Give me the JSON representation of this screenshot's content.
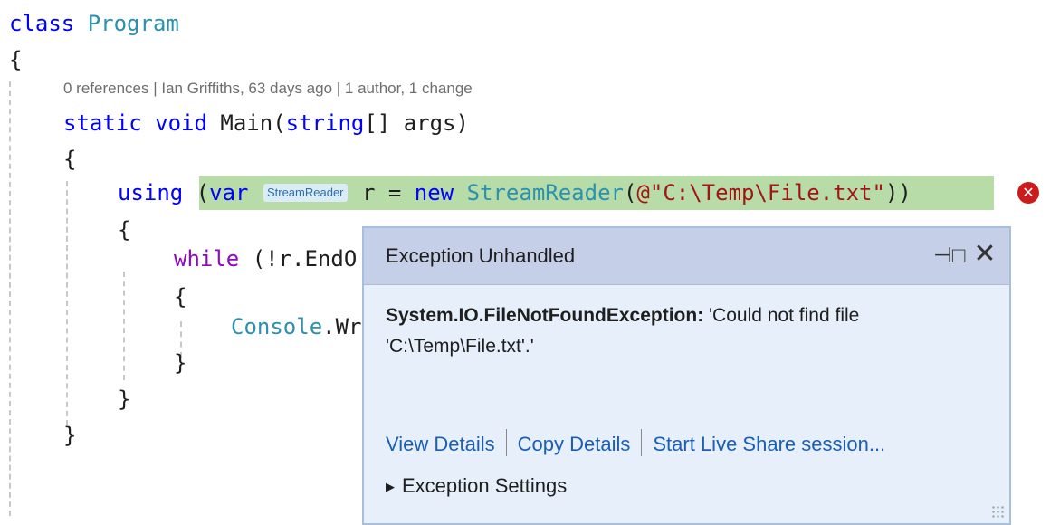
{
  "code": {
    "class_kw": "class",
    "class_name": "Program",
    "brace_open": "{",
    "brace_close": "}",
    "codelens": "0 references | Ian Griffiths, 63 days ago | 1 author, 1 change",
    "main_static": "static",
    "main_void": "void",
    "main_name": "Main(",
    "main_string": "string",
    "main_args": "[] args)",
    "using_kw": "using",
    "using_open": "(",
    "using_var": "var",
    "type_hint": "StreamReader",
    "using_mid": "r = ",
    "using_new": "new",
    "using_type": "StreamReader",
    "using_paren": "(",
    "using_str": "@\"C:\\Temp\\File.txt\"",
    "using_close": "))",
    "while_kw": "while",
    "while_rest": "(!r.EndO",
    "console_type": "Console",
    "console_rest": ".Wr"
  },
  "exception": {
    "title": "Exception Unhandled",
    "pin_icon": "pin-icon",
    "close_icon": "close-icon",
    "exception_type": "System.IO.FileNotFoundException:",
    "message": "'Could not find file 'C:\\Temp\\File.txt'.'",
    "links": [
      "View Details",
      "Copy Details",
      "Start Live Share session..."
    ],
    "settings_label": "Exception Settings"
  },
  "colors": {
    "keyword": "#0000ff",
    "control_keyword": "#8f08c4",
    "type": "#2b91af",
    "highlight": "#b8dca8",
    "error": "#cc1b1b",
    "popup_bg": "#e6effa",
    "popup_header": "#c5cfe8",
    "link": "#1a5fb4"
  }
}
